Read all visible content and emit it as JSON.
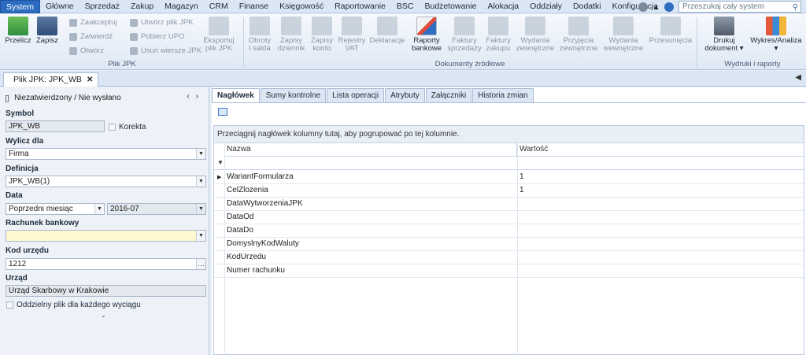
{
  "menubar": {
    "items": [
      "System",
      "Główne",
      "Sprzedaż",
      "Zakup",
      "Magazyn",
      "CRM",
      "Finanse",
      "Księgowość",
      "Raportowanie",
      "BSC",
      "Budżetowanie",
      "Alokacja",
      "Oddziały",
      "Dodatki",
      "Konfiguracja"
    ],
    "search_placeholder": "Przeszukaj cały system"
  },
  "ribbon": {
    "przelicz": "Przelicz",
    "zapisz": "Zapisz",
    "zaakceptuj": "Zaakceptuj",
    "zatwierdz": "Zatwierdź",
    "otworz": "Otwórz",
    "utworz_plik": "Utwórz plik JPK",
    "pobierz_upo": "Pobierz UPO",
    "usun_wiersze": "Usuń wiersze JPK",
    "eksportuj_1": "Eksportuj",
    "eksportuj_2": "plik JPK",
    "group_plik_jpk": "Plik JPK",
    "obroty_1": "Obroty",
    "obroty_2": "i salda",
    "zapisy_dziennik_1": "Zapisy",
    "zapisy_dziennik_2": "dziennik",
    "zapisy_konto_1": "Zapisy",
    "zapisy_konto_2": "konto",
    "rejestry_1": "Rejestry",
    "rejestry_2": "VAT",
    "deklaracje": "Deklaracje",
    "raporty_1": "Raporty",
    "raporty_2": "bankowe",
    "faktury_sp_1": "Faktury",
    "faktury_sp_2": "sprzedaży",
    "faktury_zak_1": "Faktury",
    "faktury_zak_2": "zakupu",
    "wydania_zew_1": "Wydania",
    "wydania_zew_2": "zewnętrzne",
    "przyjecia_1": "Przyjęcia",
    "przyjecia_2": "zewnętrzne",
    "wydania_wew_1": "Wydania",
    "wydania_wew_2": "wewnętrzne",
    "przesuniecia": "Przesunięcia",
    "group_dokumenty": "Dokumenty źródłowe",
    "drukuj_1": "Drukuj",
    "drukuj_2": "dokument ▾",
    "wykres_1": "Wykres/Analiza",
    "wykres_2": "▾",
    "group_wydruki": "Wydruki i raporty"
  },
  "doc_tab": {
    "label": "Plik JPK: JPK_WB"
  },
  "left": {
    "status": "Niezatwierdzony / Nie wysłano",
    "symbol_label": "Symbol",
    "symbol_value": "JPK_WB",
    "korekta_label": "Korekta",
    "wylicz_label": "Wylicz dla",
    "wylicz_value": "Firma",
    "definicja_label": "Definicja",
    "definicja_value": "JPK_WB(1)",
    "data_label": "Data",
    "data_value": "Poprzedni miesiąc",
    "data_period": "2016-07",
    "rachunek_label": "Rachunek bankowy",
    "rachunek_value": "",
    "kod_label": "Kod urzędu",
    "kod_value": "1212",
    "urzad_label": "Urząd",
    "urzad_value": "Urząd Skarbowy w Krakowie",
    "oddzielny_label": "Oddzielny plik dla każdego wyciągu"
  },
  "right": {
    "tabs": [
      "Nagłówek",
      "Sumy kontrolne",
      "Lista operacji",
      "Atrybuty",
      "Załączniki",
      "Historia zmian"
    ],
    "group_hint": "Przeciągnij nagłówek kolumny tutaj, aby pogrupować po tej kolumnie.",
    "col_name": "Nazwa",
    "col_value": "Wartość",
    "rows": [
      {
        "name": "WariantFormularza",
        "value": "1"
      },
      {
        "name": "CelZlozenia",
        "value": "1"
      },
      {
        "name": "DataWytworzeniaJPK",
        "value": ""
      },
      {
        "name": "DataOd",
        "value": ""
      },
      {
        "name": "DataDo",
        "value": ""
      },
      {
        "name": "DomyslnyKodWaluty",
        "value": ""
      },
      {
        "name": "KodUrzedu",
        "value": ""
      },
      {
        "name": "Numer rachunku",
        "value": ""
      }
    ]
  }
}
